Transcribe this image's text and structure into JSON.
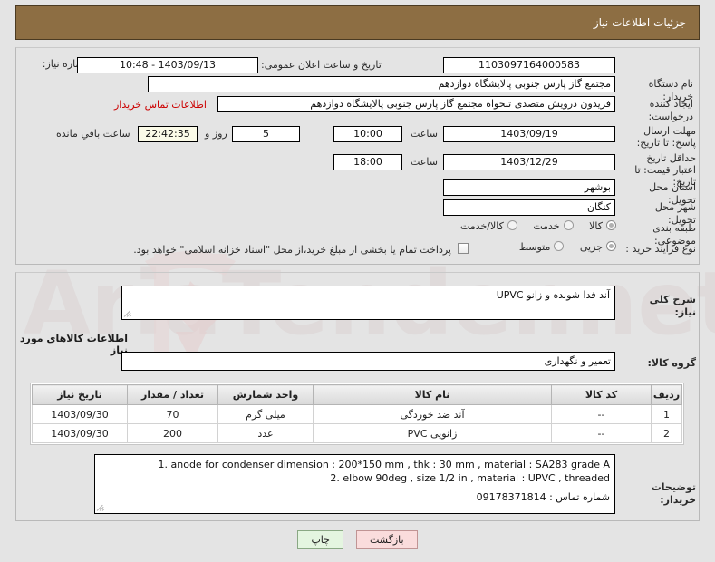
{
  "header": {
    "title": "جزئیات اطلاعات نیاز"
  },
  "form": {
    "need_number_label": "شماره نیاز:",
    "need_number_value": "1103097164000583",
    "announce_label": "تاریخ و ساعت اعلان عمومی:",
    "announce_value": "1403/09/13 - 10:48",
    "buyer_org_label": "نام دستگاه خریدار:",
    "buyer_org_value": "مجتمع گاز پارس جنوبی  پالایشگاه دوازدهم",
    "buyer_org_value2": "مجتمع گاز پارس جنوبی  پالایشگاه دوازدهم",
    "creator_label": "ایجاد کننده درخواست:",
    "creator_value": "فریدون درویش متصدی تنخواه مجتمع گاز پارس جنوبی  پالایشگاه دوازدهم",
    "contact_link": "اطلاعات تماس خریدار",
    "deadline_label": "مهلت ارسال پاسخ: تا تاریخ:",
    "deadline_date": "1403/09/19",
    "hour_label": "ساعت",
    "deadline_time": "10:00",
    "remaining_days": "5",
    "days_sep_label": "روز و",
    "remaining_clock": "22:42:35",
    "remaining_suffix": "ساعت باقي مانده",
    "price_valid_label": "حداقل تاریخ اعتبار قیمت: تا تاریخ:",
    "price_valid_date": "1403/12/29",
    "price_valid_time": "18:00",
    "province_label": "استان محل تحویل:",
    "province_value": "بوشهر",
    "city_label": "شهر محل تحویل:",
    "city_value": "کنگان",
    "category_label": "طبقه بندی موضوعی:",
    "category_options": [
      "کالا",
      "خدمت",
      "کالا/خدمت"
    ],
    "category_selected": "کالا",
    "process_label": "نوع فرآیند خرید :",
    "process_options": [
      "جزیی",
      "متوسط"
    ],
    "process_selected": "جزیی",
    "treasury_checkbox_label": "پرداخت تمام یا بخشی از مبلغ خرید،از محل \"اسناد خزانه اسلامی\" خواهد بود.",
    "treasury_checked": false
  },
  "need_desc": {
    "label": "شرح کلي نیاز:",
    "value": "آند فدا شونده و زانو UPVC"
  },
  "goods_section": {
    "heading": "اطلاعات کالاهاي مورد نیاز",
    "group_label": "گروه کالا:",
    "group_value": "تعمیر و نگهداری"
  },
  "table": {
    "columns": [
      "ردیف",
      "کد کالا",
      "نام کالا",
      "واحد شمارش",
      "تعداد / مقدار",
      "تاریخ نیاز"
    ],
    "rows": [
      {
        "row": "1",
        "code": "--",
        "name": "آند ضد خوردگی",
        "unit": "میلی گرم",
        "qty": "70",
        "date": "1403/09/30"
      },
      {
        "row": "2",
        "code": "--",
        "name": "زانویی PVC",
        "unit": "عدد",
        "qty": "200",
        "date": "1403/09/30"
      }
    ]
  },
  "buyer_notes": {
    "label": "توضیحات خریدار:",
    "line1": "1. anode for condenser dimension : 200*150 mm  , thk : 30 mm , material : SA283 grade A",
    "line2": "2. elbow 90deg , size 1/2 in , material : UPVC , threaded",
    "line3": "شماره تماس : 09178371814"
  },
  "buttons": {
    "print": "چاپ",
    "back": "بازگشت"
  },
  "watermark": {
    "text": "AriaTender.net"
  },
  "colors": {
    "header_bg": "#8d6e43",
    "page_bg": "#e4e4e4",
    "link": "#cc0000",
    "print_btn": "#e4f5e0",
    "back_btn": "#fadcdc",
    "timer_bg": "#fbfbe8"
  }
}
